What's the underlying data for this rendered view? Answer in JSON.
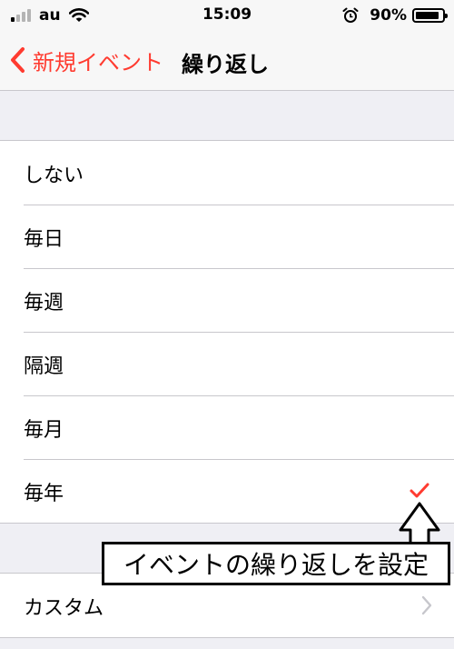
{
  "status_bar": {
    "carrier": "au",
    "time": "15:09",
    "battery_percent": "90%",
    "battery_level": 0.9,
    "signal_bars_on": 1,
    "signal_bars_total": 4
  },
  "nav": {
    "back_label": "新規イベント",
    "title": "繰り返し"
  },
  "repeat_options": {
    "items": [
      {
        "label": "しない"
      },
      {
        "label": "毎日"
      },
      {
        "label": "毎週"
      },
      {
        "label": "隔週"
      },
      {
        "label": "毎月"
      },
      {
        "label": "毎年",
        "selected": true
      }
    ]
  },
  "custom": {
    "label": "カスタム"
  },
  "annotation": {
    "text": "イベントの繰り返しを設定"
  },
  "colors": {
    "accent": "#ff3b30",
    "background": "#efeff4",
    "separator": "#c8c7cc",
    "disclosure": "#c7c7cc"
  }
}
